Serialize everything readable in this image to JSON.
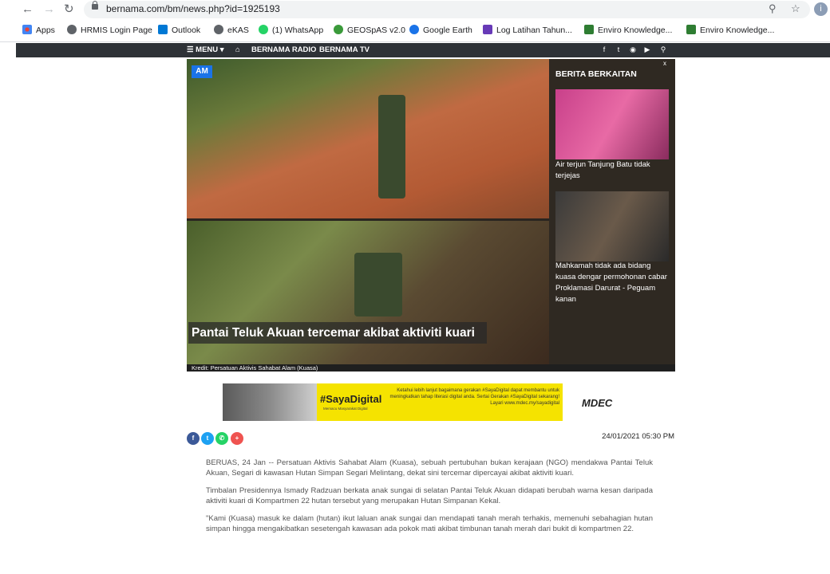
{
  "browser": {
    "url": "bernama.com/bm/news.php?id=1925193",
    "profile_initial": "i"
  },
  "bookmarks": [
    {
      "label": "Apps",
      "color": "#4285f4"
    },
    {
      "label": "HRMIS Login Page",
      "color": "#5f6368"
    },
    {
      "label": "Outlook",
      "color": "#0078d4"
    },
    {
      "label": "eKAS",
      "color": "#5f6368"
    },
    {
      "label": "(1) WhatsApp",
      "color": "#25d366"
    },
    {
      "label": "GEOSpAS v2.0",
      "color": "#3a9a3a"
    },
    {
      "label": "Google Earth",
      "color": "#1a73e8"
    },
    {
      "label": "Log Latihan Tahun...",
      "color": "#673ab7"
    },
    {
      "label": "Enviro Knowledge...",
      "color": "#2e7d32"
    },
    {
      "label": "Enviro Knowledge...",
      "color": "#2e7d32"
    }
  ],
  "site_nav": {
    "menu_label": "MENU",
    "radio_label": "BERNAMA RADIO",
    "tv_label": "BERNAMA TV"
  },
  "hero": {
    "badge": "AM",
    "headline": "Pantai Teluk Akuan tercemar akibat aktiviti kuari",
    "credit": "Kredit: Persatuan Aktivis Sahabat Alam (Kuasa)"
  },
  "related": {
    "title": "BERITA BERKAITAN",
    "close": "x",
    "items": [
      {
        "text": "Air terjun Tanjung Batu tidak terjejas"
      },
      {
        "text": "Mahkamah tidak ada bidang kuasa dengar permohonan cabar Proklamasi Darurat - Peguam kanan"
      }
    ]
  },
  "ad": {
    "brand": "#SayaDigital",
    "subtitle": "Memacu Masyarakat Digital",
    "copy": "Ketahui lebih lanjut bagaimana gerakan #SayaDigital dapat membantu untuk meningkatkan tahap literasi digital anda. Sertai Gerakan #SayaDigital sekarang! Layari www.mdec.my/sayadigital",
    "sponsor": "MDEC"
  },
  "share": {
    "plus": "+"
  },
  "article": {
    "date": "24/01/2021 05:30 PM",
    "paragraphs": [
      "BERUAS, 24 Jan -- Persatuan Aktivis Sahabat Alam (Kuasa), sebuah pertubuhan bukan kerajaan (NGO) mendakwa Pantai Teluk Akuan, Segari di kawasan Hutan Simpan Segari Melintang, dekat sini tercemar dipercayai akibat aktiviti kuari.",
      "Timbalan Presidennya Ismady Radzuan berkata anak sungai di selatan Pantai Teluk Akuan didapati berubah warna kesan daripada aktiviti kuari di Kompartmen 22 hutan tersebut yang merupakan Hutan Simpanan Kekal.",
      "\"Kami (Kuasa) masuk ke dalam (hutan) ikut laluan anak sungai dan mendapati tanah merah terhakis, memenuhi sebahagian hutan simpan hingga mengakibatkan sesetengah kawasan ada pokok mati akibat timbunan tanah merah dari bukit di kompartmen 22."
    ]
  }
}
